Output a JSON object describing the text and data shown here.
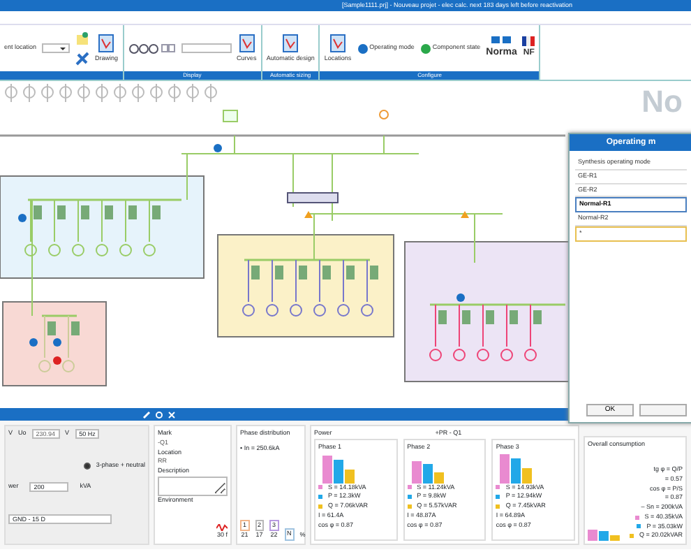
{
  "window": {
    "title": "[Sample1111.prj] - Nouveau projet - elec calc. next 183 days left before reactivation"
  },
  "ribbon": {
    "groups": [
      {
        "items": [
          {
            "kind": "small",
            "label": "ent location"
          },
          {
            "kind": "dropdown"
          },
          {
            "kind": "icon"
          },
          {
            "kind": "large",
            "label": "Drawing"
          }
        ]
      },
      {
        "label": "Display",
        "items": [
          {
            "kind": "zoom"
          },
          {
            "kind": "field"
          },
          {
            "kind": "large",
            "label": "Curves"
          }
        ]
      },
      {
        "label": "Automatic sizing",
        "items": [
          {
            "kind": "large",
            "label": "Automatic design"
          }
        ]
      },
      {
        "label": "Configure",
        "items": [
          {
            "kind": "large",
            "label": "Locations"
          },
          {
            "kind": "stack",
            "label": "Operating mode"
          },
          {
            "kind": "stack",
            "label": "Component state"
          },
          {
            "kind": "logo",
            "label": "Norma"
          },
          {
            "kind": "flag",
            "label": "NF"
          }
        ]
      }
    ]
  },
  "canvas": {
    "faded_logo": "No"
  },
  "dialog": {
    "title": "Operating m",
    "rows": [
      {
        "label": "Synthesis operating mode",
        "selected": false
      },
      {
        "label": "GE-R1",
        "selected": false
      },
      {
        "label": "GE-R2",
        "selected": false
      },
      {
        "label": "Normal-R1",
        "selected": true
      },
      {
        "label": "Normal-R2",
        "selected": false
      }
    ],
    "new_row_marker": "*",
    "buttons": [
      {
        "kind": "text",
        "label": "OK"
      },
      {
        "kind": "blank"
      }
    ]
  },
  "source": {
    "fields": [
      {
        "label": "V"
      },
      {
        "label": "Uo",
        "value": "230.94",
        "unit": "V"
      }
    ],
    "frequency": "50 Hz",
    "radio": {
      "label": "3-phase + neutral",
      "selected": true
    },
    "power": {
      "label": "wer",
      "value": "200",
      "unit": "kVA"
    },
    "earthing": "GND - 15 D"
  },
  "properties": [
    {
      "label": "Mark",
      "value": "-Q1"
    },
    {
      "label": "Location",
      "value": "RR"
    },
    {
      "label": "Description"
    },
    {
      "label": "Environment"
    }
  ],
  "phase_distribution": {
    "title": "Phase distribution",
    "current": "• In = 250.6kA",
    "bars": [
      {
        "label": "1",
        "percent": "21",
        "color": "#f2b58a"
      },
      {
        "label": "2",
        "percent": "17",
        "color": "#b8b8b8"
      },
      {
        "label": "3",
        "percent": "22",
        "color": "#b89ae0"
      },
      {
        "label": "N",
        "color": "#9fc3e0"
      }
    ],
    "unit": "%"
  },
  "power": {
    "title": "Power",
    "subtitle": "+PR - Q1",
    "phases": [
      {
        "name": "Phase 1",
        "lines": [
          "S = 14.18kVA",
          "P = 12.3kW",
          "Q = 7.06kVAR",
          "I = 61.4A",
          "cos φ = 0.87"
        ]
      },
      {
        "name": "Phase 2",
        "lines": [
          "S = 11.24kVA",
          "P = 9.8kW",
          "Q = 5.57kVAR",
          "I = 48.87A",
          "cos φ = 0.87"
        ]
      },
      {
        "name": "Phase 3",
        "lines": [
          "S = 14.93kVA",
          "P = 12.94kW",
          "Q = 7.45kVAR",
          "I = 64.89A",
          "cos φ = 0.87"
        ]
      }
    ]
  },
  "overall": {
    "title": "Overall consumption",
    "lines": [
      "tg φ = Q/P",
      "= 0.57",
      "cos φ = P/S",
      "= 0.87",
      "– Sn = 200kVA"
    ],
    "legend": [
      "S = 40.35kVA",
      "P = 35.03kW",
      "Q = 20.02kVAR"
    ]
  },
  "bottom_label": "30 f"
}
